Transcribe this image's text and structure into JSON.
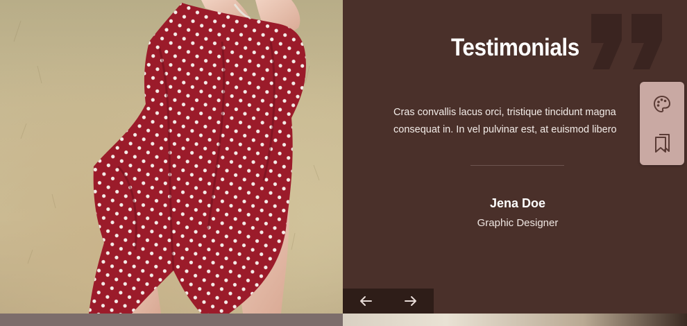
{
  "testimonials": {
    "title": "Testimonials",
    "body_lines": [
      "Cras convallis lacus orci, tristique tincidunt magna",
      "consequat in. In vel pulvinar est, at euismod libero"
    ],
    "author_name": "Jena Doe",
    "author_role": "Graphic Designer",
    "prev_icon": "arrow-left-icon",
    "next_icon": "arrow-right-icon"
  },
  "toolbar": {
    "items": [
      {
        "icon": "palette-icon"
      },
      {
        "icon": "bookmarks-icon"
      }
    ]
  },
  "colors": {
    "panel_bg": "#4a302a",
    "nav_bg": "#2e1d18",
    "toolbar_bg": "#c9a9a3",
    "dress_red": "#9b1b2a"
  }
}
